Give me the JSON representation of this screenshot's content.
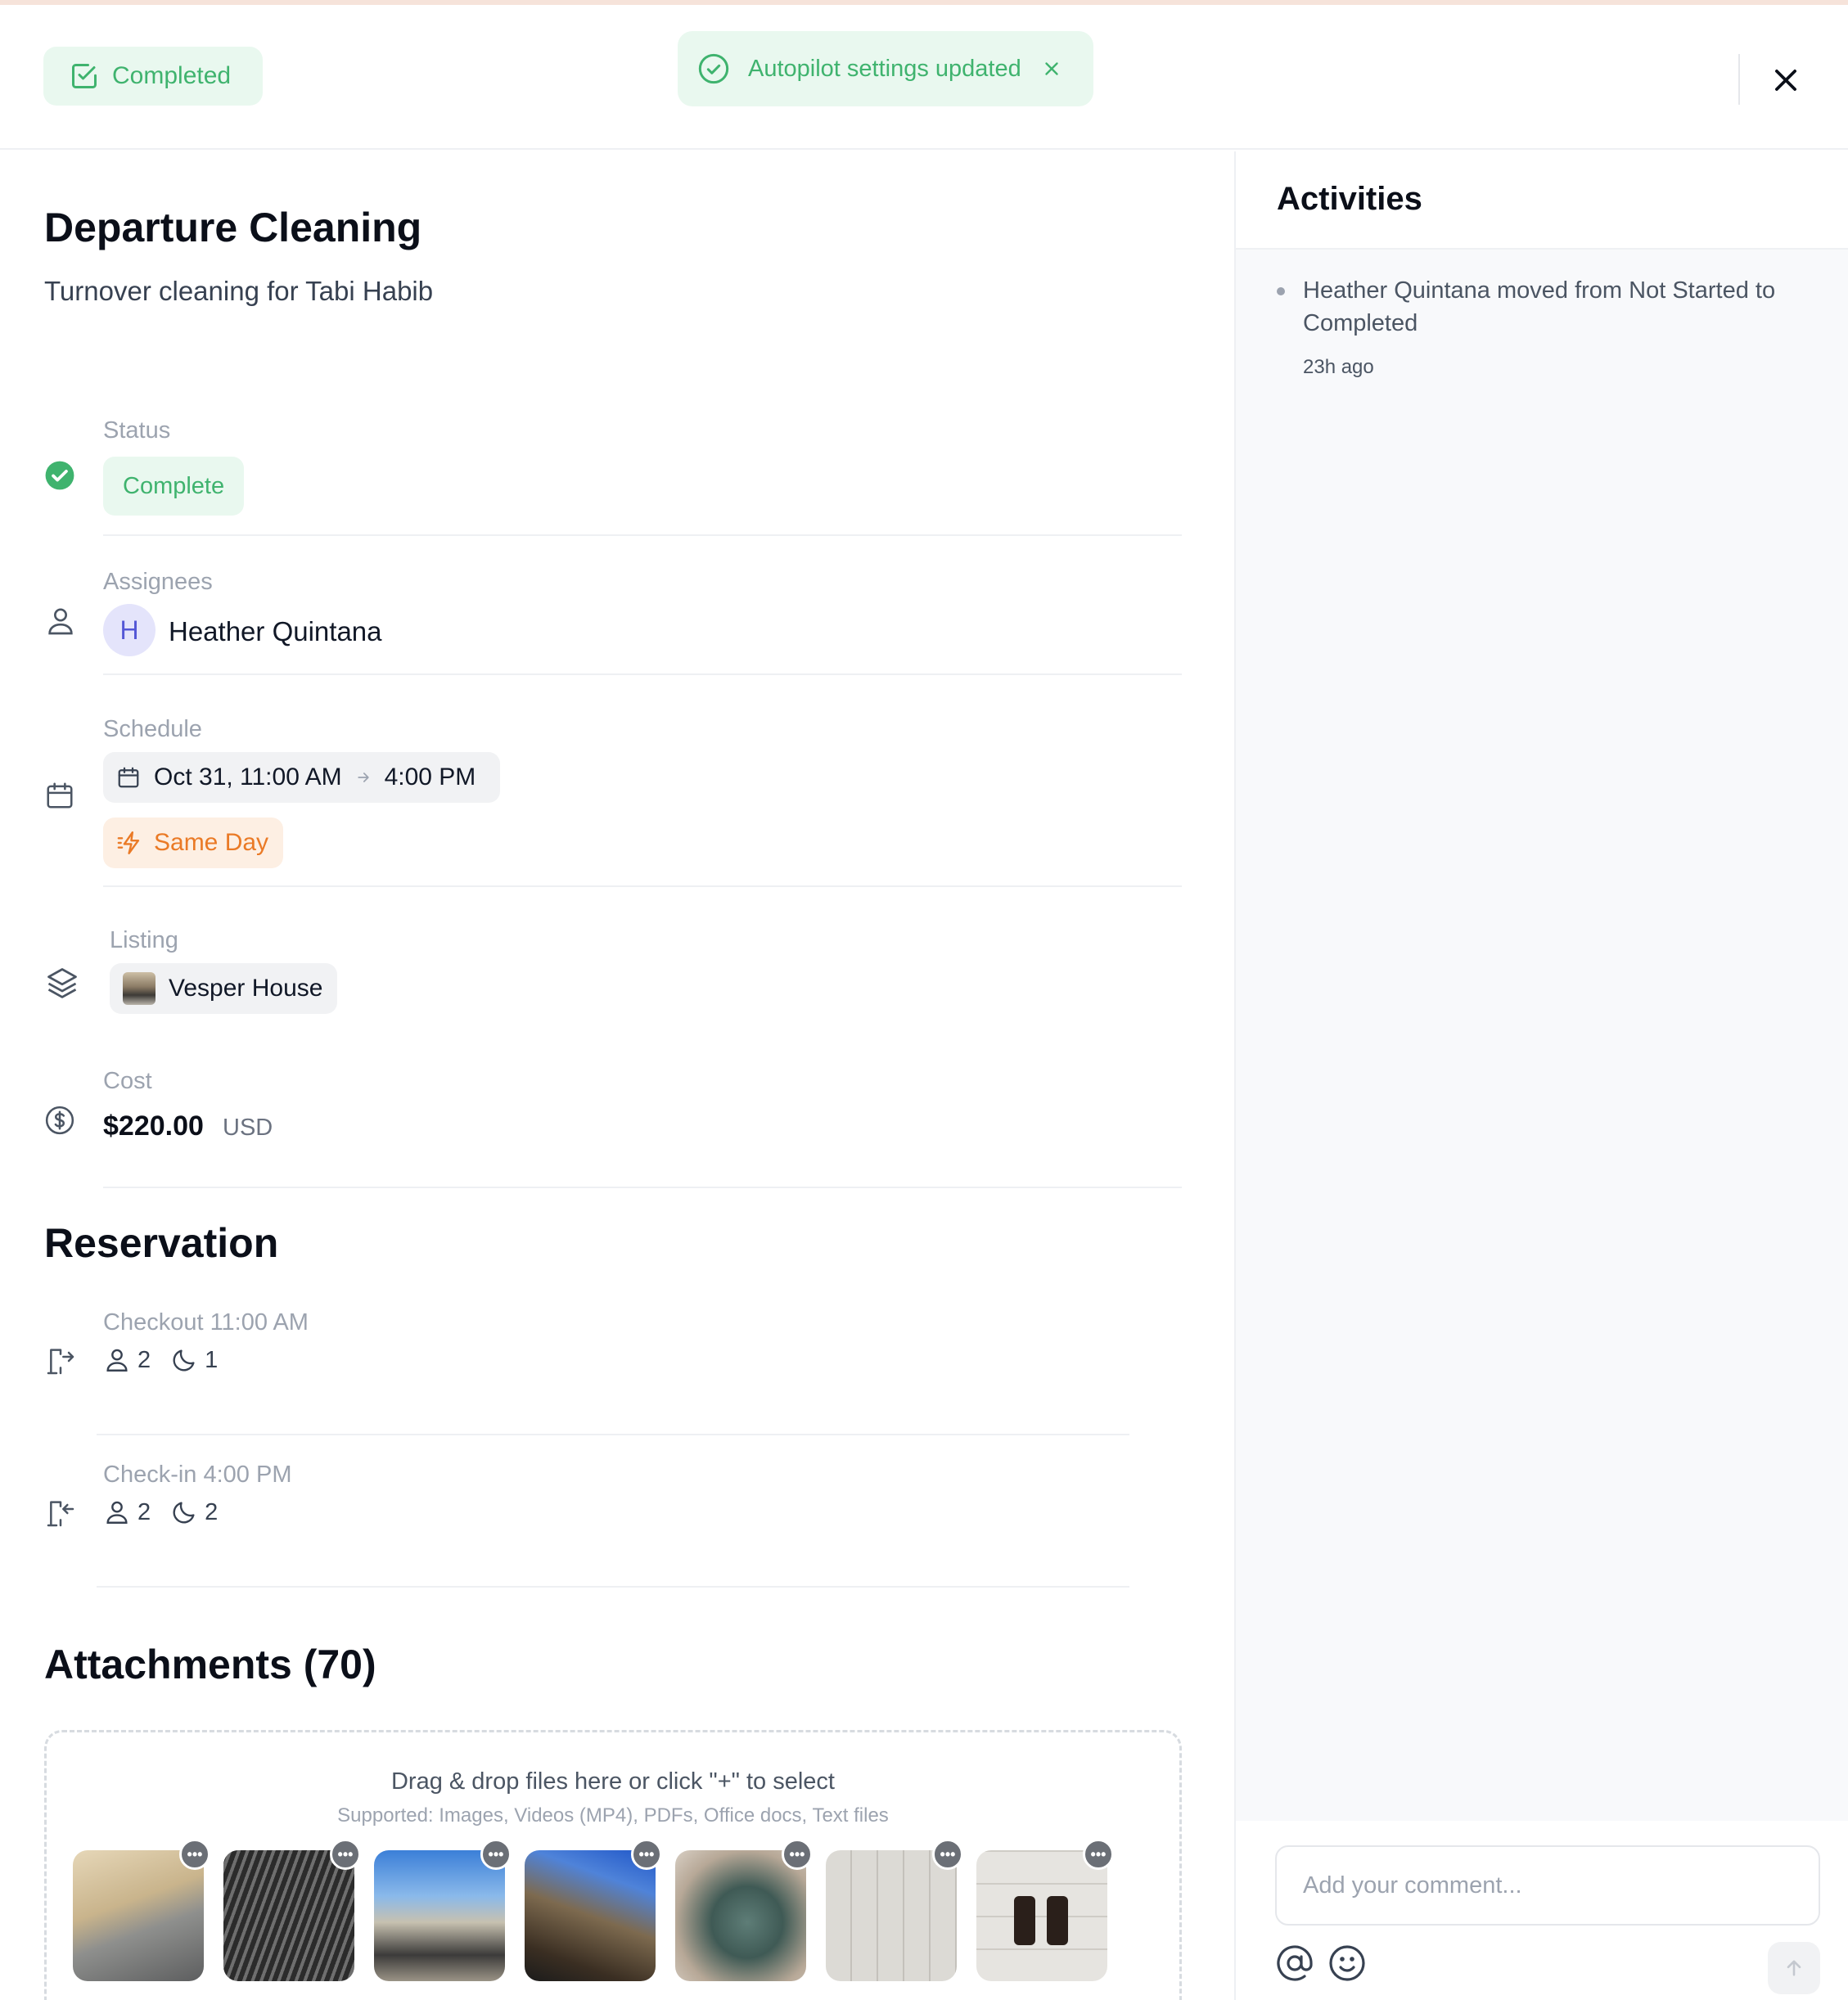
{
  "header": {
    "status_badge": "Completed",
    "toast": {
      "message": "Autopilot settings updated"
    }
  },
  "task": {
    "title": "Departure Cleaning",
    "subtitle": "Turnover cleaning for Tabi Habib",
    "status": {
      "label": "Status",
      "value": "Complete"
    },
    "assignees": {
      "label": "Assignees",
      "initial": "H",
      "name": "Heather Quintana"
    },
    "schedule": {
      "label": "Schedule",
      "start": "Oct 31, 11:00 AM",
      "end": "4:00 PM",
      "tag": "Same Day"
    },
    "listing": {
      "label": "Listing",
      "name": "Vesper House"
    },
    "cost": {
      "label": "Cost",
      "amount": "$220.00",
      "currency": "USD"
    }
  },
  "reservation": {
    "title": "Reservation",
    "checkout": {
      "label": "Checkout 11:00 AM",
      "guests": "2",
      "nights": "1"
    },
    "checkin": {
      "label": "Check-in 4:00 PM",
      "guests": "2",
      "nights": "2"
    }
  },
  "attachments": {
    "title": "Attachments (70)",
    "dropzone_text": "Drag & drop files here or click \"+\" to select",
    "supported_text": "Supported: Images, Videos (MP4), PDFs, Office docs, Text files"
  },
  "activities": {
    "title": "Activities",
    "items": [
      {
        "text": "Heather Quintana moved from Not Started to Completed",
        "time": "23h ago"
      }
    ]
  },
  "composer": {
    "placeholder": "Add your comment..."
  },
  "colors": {
    "success": "#3fb36e",
    "warning": "#ea7a26",
    "avatar": "#5457d6"
  }
}
